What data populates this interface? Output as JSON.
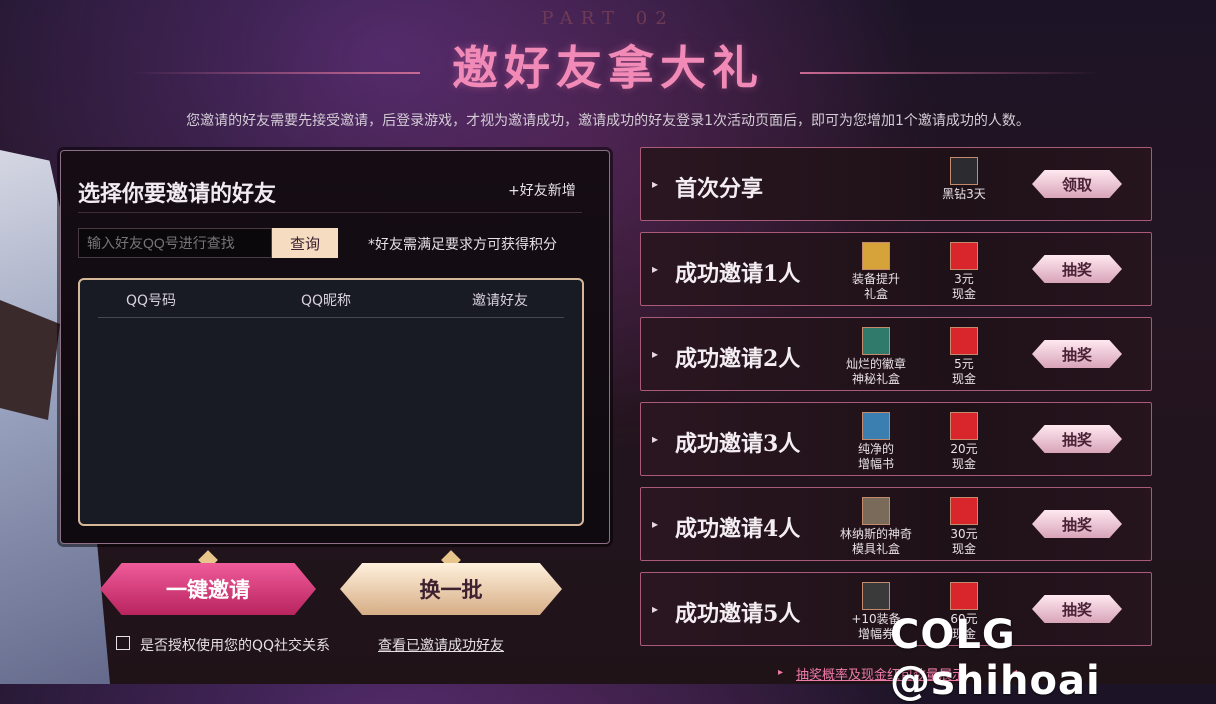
{
  "header": {
    "part_label": "PART 02",
    "title": "邀好友拿大礼",
    "subtitle": "您邀请的好友需要先接受邀请，后登录游戏，才视为邀请成功，邀请成功的好友登录1次活动页面后，即可为您增加1个邀请成功的人数。"
  },
  "invite_panel": {
    "heading": "选择你要邀请的好友",
    "add_friend": "+好友新增",
    "search_placeholder": "输入好友QQ号进行查找",
    "query_button": "查询",
    "note": "*好友需满足要求方可获得积分",
    "columns": [
      "QQ号码",
      "QQ昵称",
      "邀请好友"
    ]
  },
  "actions": {
    "invite_all": "一键邀请",
    "refresh_batch": "换一批",
    "authorize_label": "是否授权使用您的QQ社交关系",
    "view_invited": "查看已邀请成功好友"
  },
  "rewards": [
    {
      "title": "首次分享",
      "items": [
        {
          "label": "黑钻3天",
          "icon": "black-diamond-icon"
        }
      ],
      "button": "领取"
    },
    {
      "title": "成功邀请1人",
      "items": [
        {
          "label": "装备提升\n礼盒",
          "icon": "equipment-box-icon"
        },
        {
          "label": "3元\n现金",
          "icon": "red-packet-icon"
        }
      ],
      "button": "抽奖"
    },
    {
      "title": "成功邀请2人",
      "items": [
        {
          "label": "灿烂的徽章\n神秘礼盒",
          "icon": "badge-box-icon"
        },
        {
          "label": "5元\n现金",
          "icon": "red-packet-icon"
        }
      ],
      "button": "抽奖"
    },
    {
      "title": "成功邀请3人",
      "items": [
        {
          "label": "纯净的\n增幅书",
          "icon": "amplify-book-icon"
        },
        {
          "label": "20元\n现金",
          "icon": "red-packet-icon"
        }
      ],
      "button": "抽奖"
    },
    {
      "title": "成功邀请4人",
      "items": [
        {
          "label": "林纳斯的神奇\n模具礼盒",
          "icon": "mold-box-icon"
        },
        {
          "label": "30元\n现金",
          "icon": "red-packet-icon"
        }
      ],
      "button": "抽奖"
    },
    {
      "title": "成功邀请5人",
      "items": [
        {
          "label": "+10装备\n增幅券",
          "icon": "plus10-ticket-icon"
        },
        {
          "label": "60元\n现金",
          "icon": "red-packet-icon"
        }
      ],
      "button": "抽奖"
    }
  ],
  "footer": {
    "probability_link": "抽奖概率及现金红包数量展示"
  },
  "watermark": "COLG @shihoai",
  "colors": {
    "accent_pink": "#f18ab6",
    "invite_button": "#e04584",
    "gold": "#f6dcc0"
  }
}
